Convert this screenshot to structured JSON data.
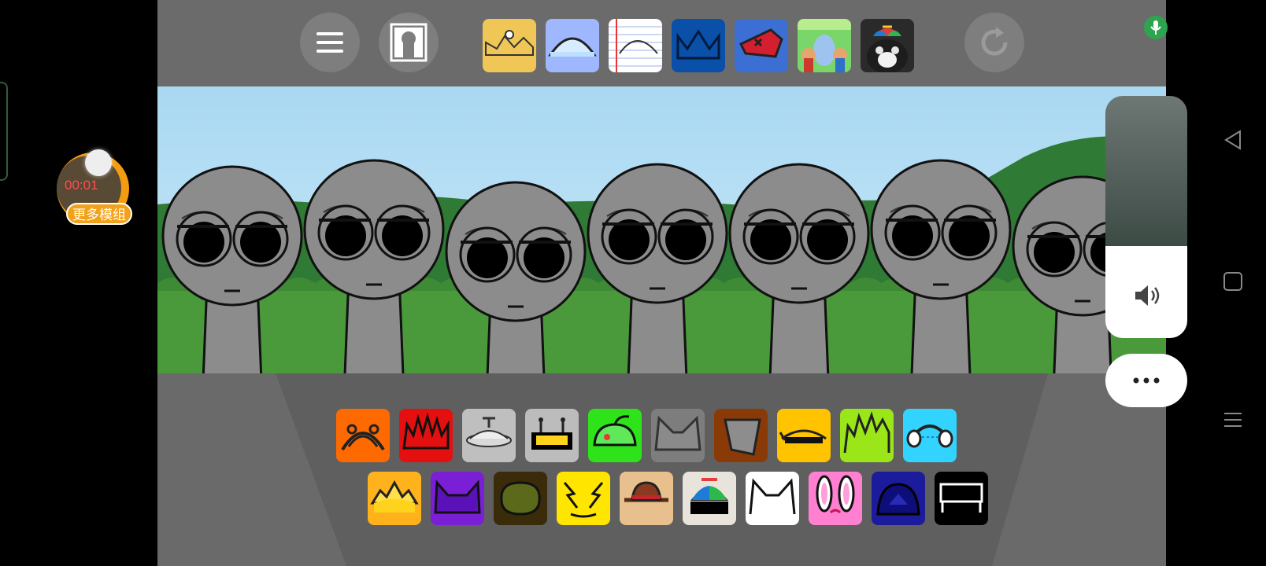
{
  "recorder": {
    "time": "00:01",
    "badge": "更多模组"
  },
  "toolbar": {
    "menu_icon": "hamburger-menu-icon",
    "frame_icon": "keyhole-frame-icon",
    "reset_icon": "refresh-icon",
    "mod_slots": [
      "yellow-crown-mod",
      "blue-dome-mod",
      "notebook-paper-mod",
      "dark-blue-crown-mod",
      "red-blue-hat-mod",
      "green-characters-mod",
      "cat-propeller-mod"
    ]
  },
  "scene": {
    "characters": [
      "character-1",
      "character-2",
      "character-3",
      "character-4",
      "character-5",
      "character-6",
      "character-7"
    ]
  },
  "palette": {
    "row1": [
      {
        "name": "orange-antenna-sound",
        "bg": "#ff6a00"
      },
      {
        "name": "red-spiky-sound",
        "bg": "#e41010"
      },
      {
        "name": "silver-plate-sound",
        "bg": "#bfbfbf"
      },
      {
        "name": "robot-visor-sound",
        "bg": "#bcbcbc"
      },
      {
        "name": "green-pepper-sound",
        "bg": "#2fe31a"
      },
      {
        "name": "grey-cat-ears-sound",
        "bg": "#7d7d7d"
      },
      {
        "name": "brown-bucket-sound",
        "bg": "#8a3a06"
      },
      {
        "name": "yellow-visor-sound",
        "bg": "#ffc300"
      },
      {
        "name": "lime-hair-sound",
        "bg": "#9ae618"
      },
      {
        "name": "blue-headphones-sound",
        "bg": "#33d3ff"
      }
    ],
    "row2": [
      {
        "name": "sunrise-crown-sound",
        "bg": "#ffb21c"
      },
      {
        "name": "purple-horns-sound",
        "bg": "#7b1fd6"
      },
      {
        "name": "olive-bush-sound",
        "bg": "#3a2b0a"
      },
      {
        "name": "yellow-lightning-sound",
        "bg": "#ffe500"
      },
      {
        "name": "fedora-sound",
        "bg": "#e8c08e"
      },
      {
        "name": "propeller-cap-sound",
        "bg": "#e8e4dc"
      },
      {
        "name": "white-cat-ears-sound",
        "bg": "#ffffff"
      },
      {
        "name": "pink-bunny-sound",
        "bg": "#ff7fd0"
      },
      {
        "name": "navy-dome-sound",
        "bg": "#1b1b9c"
      },
      {
        "name": "black-bench-sound",
        "bg": "#000000"
      }
    ]
  },
  "side_controls": {
    "volume_level": 0.38,
    "volume_icon": "speaker-icon",
    "more_icon": "more-dots-icon",
    "mic_icon": "microphone-icon"
  },
  "android_nav": {
    "back_icon": "back-triangle-icon",
    "home_icon": "home-square-icon",
    "menu_icon": "menu-lines-icon"
  }
}
